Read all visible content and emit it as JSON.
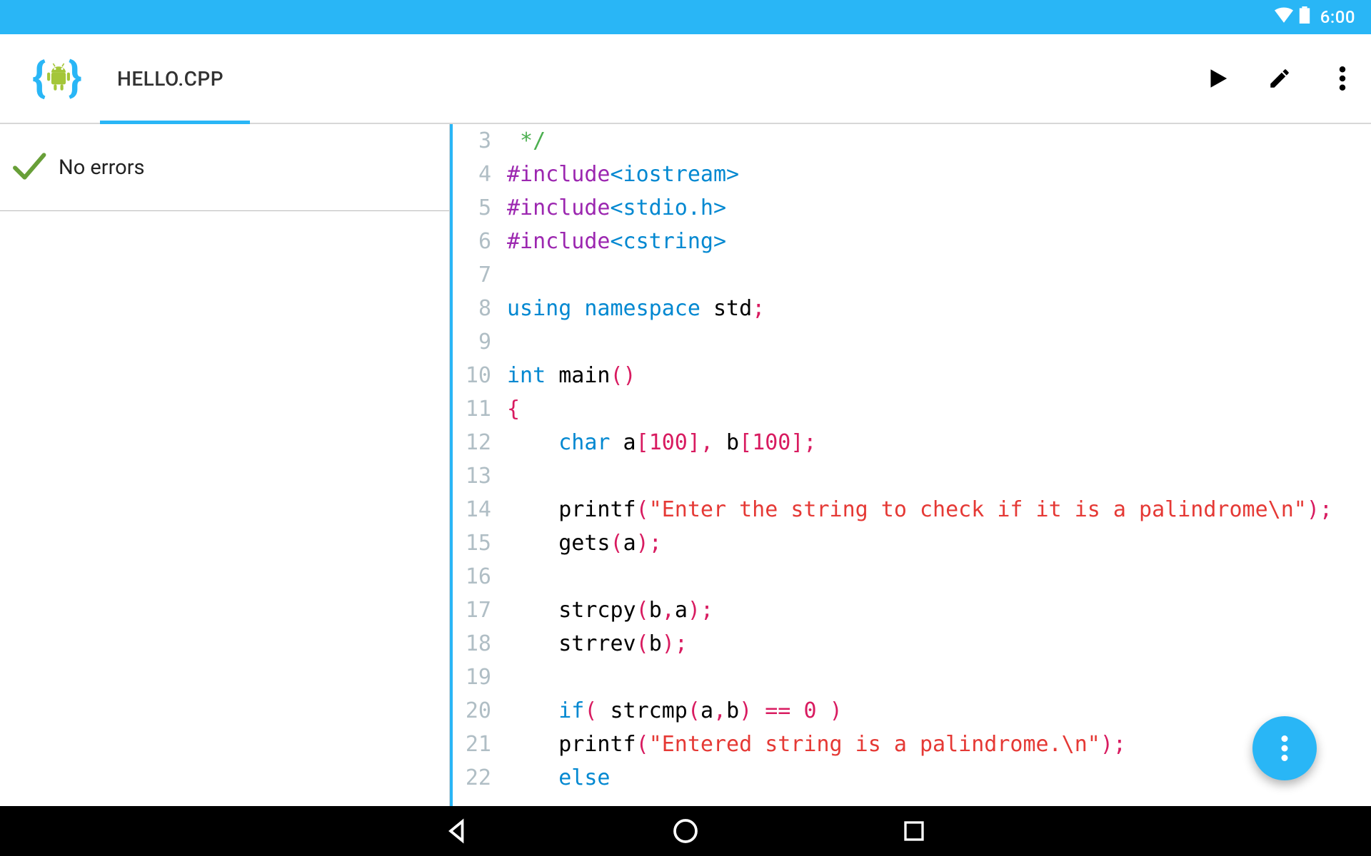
{
  "status_bar": {
    "time": "6:00"
  },
  "app_bar": {
    "title": "HELLO.CPP"
  },
  "sidebar": {
    "status": "No errors"
  },
  "fab": {
    "label": "more"
  },
  "code": {
    "first_line_number": 3,
    "lines": [
      {
        "n": 3,
        "tokens": [
          [
            "cmt",
            " */"
          ]
        ]
      },
      {
        "n": 4,
        "tokens": [
          [
            "pp",
            "#include"
          ],
          [
            "inc",
            "<iostream>"
          ]
        ]
      },
      {
        "n": 5,
        "tokens": [
          [
            "pp",
            "#include"
          ],
          [
            "inc",
            "<stdio.h>"
          ]
        ]
      },
      {
        "n": 6,
        "tokens": [
          [
            "pp",
            "#include"
          ],
          [
            "inc",
            "<cstring>"
          ]
        ]
      },
      {
        "n": 7,
        "tokens": []
      },
      {
        "n": 8,
        "tokens": [
          [
            "kw",
            "using"
          ],
          [
            "",
            " "
          ],
          [
            "kw",
            "namespace"
          ],
          [
            "",
            " std"
          ],
          [
            "punct",
            ";"
          ]
        ]
      },
      {
        "n": 9,
        "tokens": []
      },
      {
        "n": 10,
        "tokens": [
          [
            "type",
            "int"
          ],
          [
            "",
            " main"
          ],
          [
            "paren",
            "()"
          ]
        ]
      },
      {
        "n": 11,
        "tokens": [
          [
            "punct",
            "{"
          ]
        ]
      },
      {
        "n": 12,
        "tokens": [
          [
            "",
            "    "
          ],
          [
            "type",
            "char"
          ],
          [
            "",
            " a"
          ],
          [
            "punct",
            "["
          ],
          [
            "num",
            "100"
          ],
          [
            "punct",
            "],"
          ],
          [
            "",
            " b"
          ],
          [
            "punct",
            "["
          ],
          [
            "num",
            "100"
          ],
          [
            "punct",
            "];"
          ]
        ]
      },
      {
        "n": 13,
        "tokens": []
      },
      {
        "n": 14,
        "tokens": [
          [
            "",
            "    printf"
          ],
          [
            "paren",
            "("
          ],
          [
            "str",
            "\"Enter the string to check if it is a palindrome\\n\""
          ],
          [
            "paren",
            ")"
          ],
          [
            "punct",
            ";"
          ]
        ]
      },
      {
        "n": 15,
        "tokens": [
          [
            "",
            "    gets"
          ],
          [
            "paren",
            "("
          ],
          [
            "",
            "a"
          ],
          [
            "paren",
            ")"
          ],
          [
            "punct",
            ";"
          ]
        ]
      },
      {
        "n": 16,
        "tokens": []
      },
      {
        "n": 17,
        "tokens": [
          [
            "",
            "    strcpy"
          ],
          [
            "paren",
            "("
          ],
          [
            "",
            "b"
          ],
          [
            "punct",
            ","
          ],
          [
            "",
            "a"
          ],
          [
            "paren",
            ")"
          ],
          [
            "punct",
            ";"
          ]
        ]
      },
      {
        "n": 18,
        "tokens": [
          [
            "",
            "    strrev"
          ],
          [
            "paren",
            "("
          ],
          [
            "",
            "b"
          ],
          [
            "paren",
            ")"
          ],
          [
            "punct",
            ";"
          ]
        ]
      },
      {
        "n": 19,
        "tokens": []
      },
      {
        "n": 20,
        "tokens": [
          [
            "",
            "    "
          ],
          [
            "kw",
            "if"
          ],
          [
            "paren",
            "("
          ],
          [
            "",
            " strcmp"
          ],
          [
            "paren",
            "("
          ],
          [
            "",
            "a"
          ],
          [
            "punct",
            ","
          ],
          [
            "",
            "b"
          ],
          [
            "paren",
            ")"
          ],
          [
            "",
            " "
          ],
          [
            "punct",
            "=="
          ],
          [
            "",
            " "
          ],
          [
            "num",
            "0"
          ],
          [
            "",
            " "
          ],
          [
            "paren",
            ")"
          ]
        ]
      },
      {
        "n": 21,
        "tokens": [
          [
            "",
            "    printf"
          ],
          [
            "paren",
            "("
          ],
          [
            "str",
            "\"Entered string is a palindrome.\\n\""
          ],
          [
            "paren",
            ")"
          ],
          [
            "punct",
            ";"
          ]
        ]
      },
      {
        "n": 22,
        "tokens": [
          [
            "",
            "    "
          ],
          [
            "kw",
            "else"
          ]
        ]
      }
    ]
  }
}
